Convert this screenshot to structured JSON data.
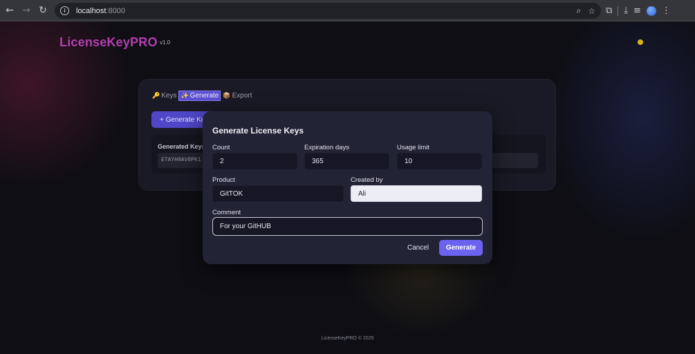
{
  "browser": {
    "url_host": "localhost",
    "url_port": ":8000"
  },
  "app": {
    "logo": "LicenseKeyPRO",
    "version": "v1.0",
    "footer": "LicenseKeyPRO © 2025"
  },
  "tabs": [
    {
      "icon": "🔑",
      "label": "Keys"
    },
    {
      "icon": "✨",
      "label": "Generate"
    },
    {
      "icon": "📦",
      "label": "Export"
    }
  ],
  "card": {
    "generate_keys_button": "+ Generate Keys",
    "generated_keys_label": "Generated Keys",
    "generated_key_value": "ETAYH9AV8PK1"
  },
  "modal": {
    "title": "Generate License Keys",
    "count_label": "Count",
    "count_value": "2",
    "expiration_label": "Expiration days",
    "expiration_value": "365",
    "usage_label": "Usage limit",
    "usage_value": "10",
    "product_label": "Product",
    "product_value": "GitTOK",
    "created_by_label": "Created by",
    "created_by_value": "Ali",
    "comment_label": "Comment",
    "comment_value": "For your GitHUB",
    "cancel_label": "Cancel",
    "generate_label": "Generate"
  },
  "colors": {
    "logo": "#b33fb0",
    "accent": "#6b63f0",
    "theme_dot": "#d8b21a"
  }
}
